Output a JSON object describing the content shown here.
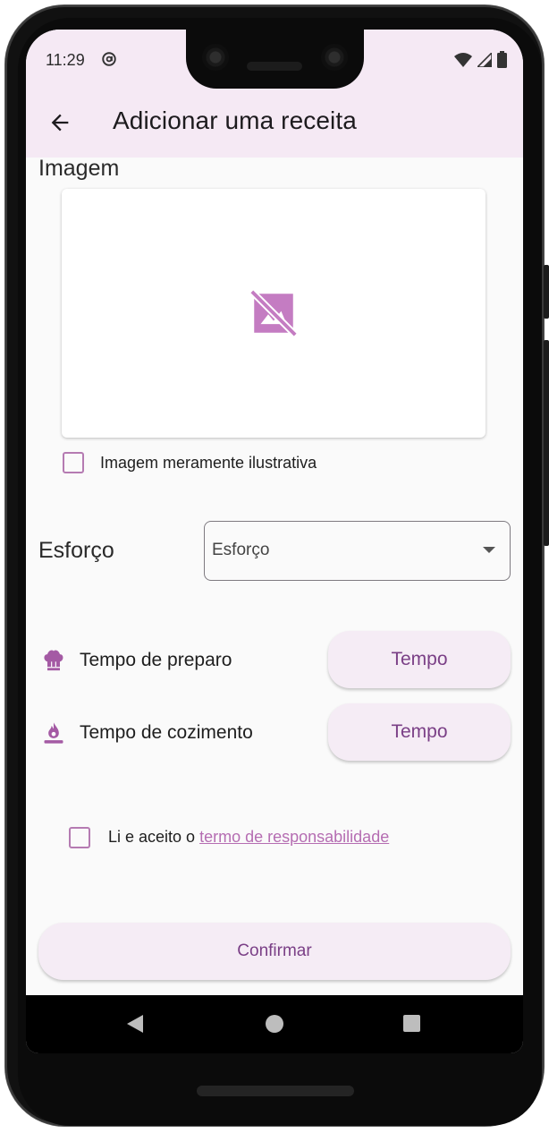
{
  "status_bar": {
    "time": "11:29",
    "icons": [
      "at-sign-icon",
      "wifi-icon",
      "signal-icon",
      "battery-icon"
    ]
  },
  "app_bar": {
    "back_icon": "arrow-back-icon",
    "title": "Adicionar uma receita"
  },
  "image_section": {
    "title": "Imagem",
    "placeholder_icon": "image-not-supported-icon",
    "illustrative_checkbox_label": "Imagem meramente ilustrativa",
    "illustrative_checked": false
  },
  "effort": {
    "label": "Esforço",
    "dropdown_placeholder": "Esforço"
  },
  "times": [
    {
      "icon": "chef-hat-icon",
      "label": "Tempo de preparo",
      "button": "Tempo"
    },
    {
      "icon": "burner-flame-icon",
      "label": "Tempo de cozimento",
      "button": "Tempo"
    }
  ],
  "terms": {
    "prefix": "Li e aceito o ",
    "link": "termo de responsabilidade",
    "checked": false
  },
  "confirm_button": "Confirmar",
  "colors": {
    "accent": "#b57bb2",
    "button_text": "#7a3f86",
    "app_bar_bg": "#f5e9f4",
    "button_bg": "#f5ecf5"
  },
  "nav_bar": {
    "icons": [
      "nav-back-icon",
      "nav-home-icon",
      "nav-recents-icon"
    ]
  }
}
